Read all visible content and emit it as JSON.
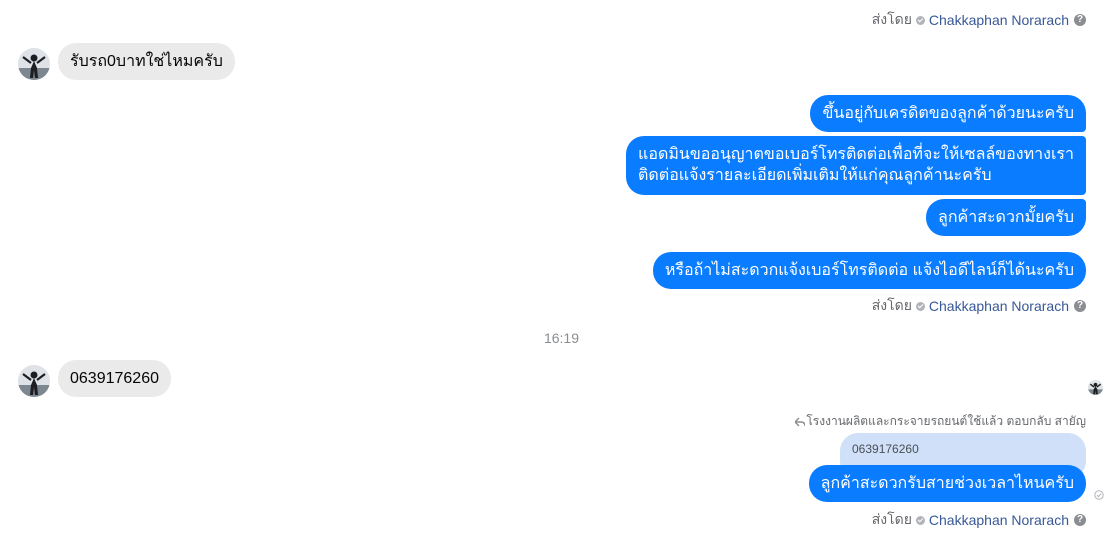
{
  "sent_by": {
    "prefix": "ส่งโดย",
    "name": "Chakkaphan Norarach",
    "help_glyph": "?"
  },
  "incoming": [
    {
      "text": "รับรถ0บาทใช่ไหมครับ"
    },
    {
      "text": "0639176260"
    }
  ],
  "outgoing_group1": [
    {
      "text": "ขึ้นอยู่กับเครดิตของลูกค้าด้วยนะครับ"
    },
    {
      "line1": "แอดมินขออนุญาตขอเบอร์โทรติดต่อเพื่อที่จะให้เซลล์ของทางเรา",
      "line2": "ติดต่อแจ้งรายละเอียดเพิ่มเติมให้แก่คุณลูกค้านะครับ"
    },
    {
      "text": "ลูกค้าสะดวกมั้ยครับ"
    },
    {
      "text": "หรือถ้าไม่สะดวกแจ้งเบอร์โทรติดต่อ แจ้งไอดีไลน์ก็ได้นะครับ"
    }
  ],
  "timestamp": "16:19",
  "reply": {
    "label": "โรงงานผลิตและกระจายรถยนต์ใช้แล้ว ตอบกลับ สายัญ",
    "quoted": "0639176260",
    "text": "ลูกค้าสะดวกรับสายช่วงเวลาไหนครับ"
  },
  "colors": {
    "outgoing_bubble": "#0a7cff",
    "incoming_bubble": "#eaeaea",
    "quote_bubble": "#cfe0f8",
    "sender_link": "#385898"
  }
}
